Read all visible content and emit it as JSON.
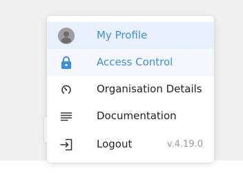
{
  "menu": {
    "items": [
      {
        "label": "My Profile",
        "icon": "avatar-icon",
        "state": "active"
      },
      {
        "label": "Access Control",
        "icon": "lock-icon",
        "state": "hover"
      },
      {
        "label": "Organisation Details",
        "icon": "gauge-icon",
        "state": "normal"
      },
      {
        "label": "Documentation",
        "icon": "document-lines-icon",
        "state": "normal"
      },
      {
        "label": "Logout",
        "icon": "logout-icon",
        "state": "normal"
      }
    ],
    "version": "v.4.19.0"
  },
  "colors": {
    "accent": "#3f8edc",
    "active_bg": "#e8f1fd",
    "hover_bg": "#f4f8fe",
    "text": "#222222",
    "muted": "#999999"
  }
}
